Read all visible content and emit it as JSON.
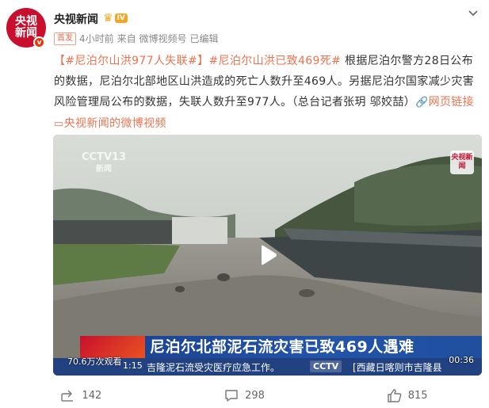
{
  "author": {
    "avatar_text": "央视新闻",
    "verified_mark": "v",
    "name": "央视新闻",
    "vip_level": "IV"
  },
  "meta": {
    "first_tag": "首发",
    "time": "4小时前",
    "source": "来自 微博视频号",
    "edited": "已编辑"
  },
  "post": {
    "hashtag1": "【#尼泊尔山洪977人失联#】",
    "hashtag2": "#尼泊尔山洪已致469死#",
    "body": "根据尼泊尔警方28日公布的数据，尼泊尔北部地区山洪造成的死亡人数升至469人。另据尼泊尔国家减少灾害风险管理局公布的数据，失联人数升至977人。（总台记者张玥 邬姣喆）",
    "web_link_label": "网页链接",
    "video_link_label": "央视新闻的微博视频"
  },
  "video": {
    "cctv_logo": "CCTV13",
    "cctv_logo_sub": "新闻",
    "corner_logo": "央视新闻",
    "banner_title": "尼泊尔北部泥石流灾害已致469人遇难",
    "ticker_left": "吉隆泥石流受灾医疗应急工作。",
    "ticker_cctv": "CCTV",
    "ticker_right": "[西藏日喀则市吉隆县",
    "timestamp": "1:15",
    "views": "70.6万次观看",
    "duration": "00:36"
  },
  "actions": {
    "share_count": "142",
    "comment_count": "298",
    "like_count": "815"
  },
  "colors": {
    "brand_red": "#c8102e",
    "link_orange": "#eb7350",
    "banner_blue": "#2354a8"
  },
  "icons": [
    "share-icon",
    "comment-icon",
    "like-icon",
    "chevron-down-icon",
    "play-icon",
    "link-icon",
    "video-icon",
    "crown-icon"
  ]
}
